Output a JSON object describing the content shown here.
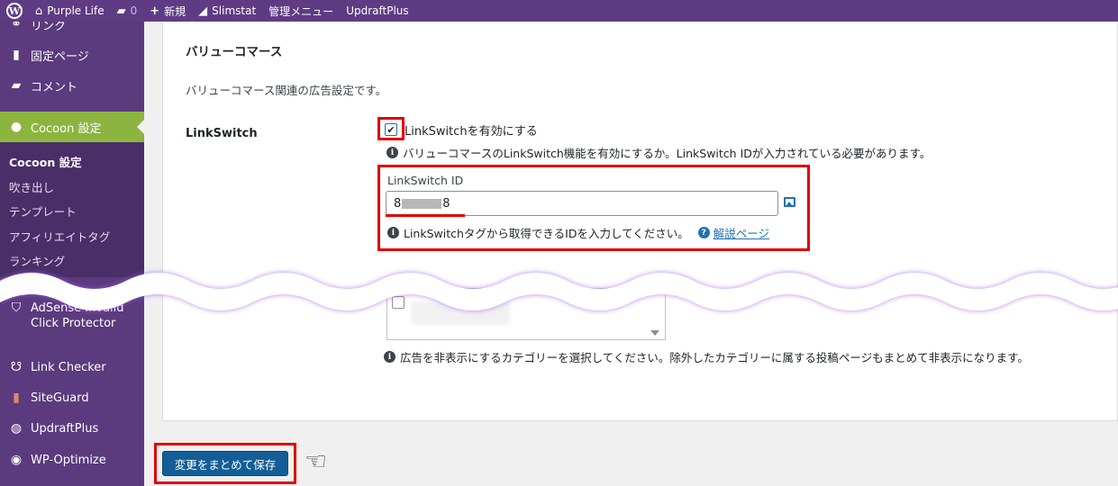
{
  "adminbar": {
    "site_name": "Purple Life",
    "comments_count": "0",
    "new_label": "新規",
    "slimstat_label": "Slimstat",
    "admin_menu_label": "管理メニュー",
    "updraft_label": "UpdraftPlus"
  },
  "sidebar": {
    "links_label": "リンク",
    "pages_label": "固定ページ",
    "comments_label": "コメント",
    "cocoon_label": "Cocoon 設定",
    "submenu": [
      "Cocoon 設定",
      "吹き出し",
      "テンプレート",
      "アフィリエイトタグ",
      "ランキング"
    ],
    "adsense_label": "AdSense Invalid",
    "adsense_label2": "Click Protector",
    "link_checker_label": "Link Checker",
    "siteguard_label": "SiteGuard",
    "updraft_label": "UpdraftPlus",
    "wpoptimize_label": "WP-Optimize"
  },
  "section": {
    "title": "バリューコマース",
    "description": "バリューコマース関連の広告設定です。",
    "row_label": "LinkSwitch",
    "checkbox_label": "LinkSwitchを有効にする",
    "checkbox_checked": true,
    "checkbox_help": "バリューコマースのLinkSwitch機能を有効にするか。LinkSwitch IDが入力されている必要があります。",
    "id_label": "LinkSwitch ID",
    "id_value_start": "8",
    "id_value_end": "8",
    "id_help": "LinkSwitchタグから取得できるIDを入力してください。",
    "id_help_link": "解説ページ",
    "category_help": "広告を非表示にするカテゴリーを選択してください。除外したカテゴリーに属する投稿ページもまとめて非表示になります。"
  },
  "save_button": "変更をまとめて保存",
  "colors": {
    "adminbar": "#5f3b84",
    "sidebar": "#5b3a7e",
    "active_menu": "#8cb53f",
    "highlight": "#e00000",
    "button": "#135e96"
  }
}
